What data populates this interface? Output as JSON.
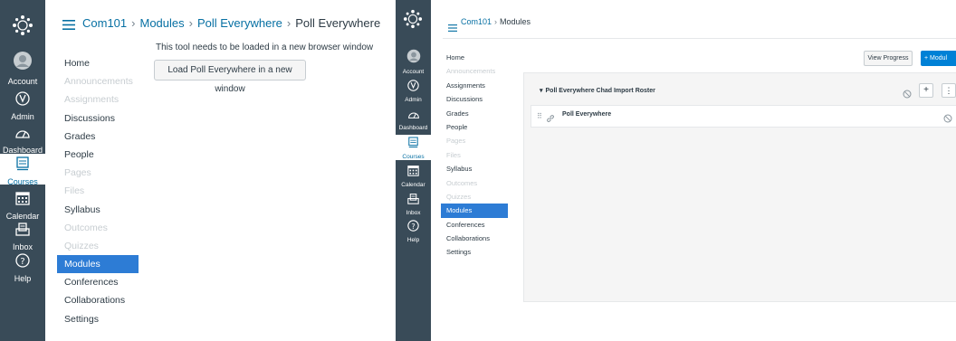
{
  "left": {
    "global_nav": {
      "items": [
        {
          "label": "Account",
          "icon": "account-icon"
        },
        {
          "label": "Admin",
          "icon": "admin-icon"
        },
        {
          "label": "Dashboard",
          "icon": "dashboard-icon"
        },
        {
          "label": "Courses",
          "icon": "courses-icon",
          "active": true
        },
        {
          "label": "Calendar",
          "icon": "calendar-icon"
        },
        {
          "label": "Inbox",
          "icon": "inbox-icon"
        },
        {
          "label": "Help",
          "icon": "help-icon"
        }
      ]
    },
    "breadcrumbs": [
      "Com101",
      "Modules",
      "Poll Everywhere",
      "Poll Everywhere"
    ],
    "course_nav": [
      {
        "label": "Home",
        "state": "normal"
      },
      {
        "label": "Announcements",
        "state": "disabled"
      },
      {
        "label": "Assignments",
        "state": "disabled"
      },
      {
        "label": "Discussions",
        "state": "normal"
      },
      {
        "label": "Grades",
        "state": "normal"
      },
      {
        "label": "People",
        "state": "normal"
      },
      {
        "label": "Pages",
        "state": "disabled"
      },
      {
        "label": "Files",
        "state": "disabled"
      },
      {
        "label": "Syllabus",
        "state": "normal"
      },
      {
        "label": "Outcomes",
        "state": "disabled"
      },
      {
        "label": "Quizzes",
        "state": "disabled"
      },
      {
        "label": "Modules",
        "state": "active"
      },
      {
        "label": "Conferences",
        "state": "normal"
      },
      {
        "label": "Collaborations",
        "state": "normal"
      },
      {
        "label": "Settings",
        "state": "normal"
      }
    ],
    "message": "This tool needs to be loaded in a new browser window",
    "load_button": "Load Poll Everywhere in a new window"
  },
  "right": {
    "global_nav": {
      "items": [
        {
          "label": "Account",
          "icon": "account-icon"
        },
        {
          "label": "Admin",
          "icon": "admin-icon"
        },
        {
          "label": "Dashboard",
          "icon": "dashboard-icon"
        },
        {
          "label": "Courses",
          "icon": "courses-icon",
          "active": true
        },
        {
          "label": "Calendar",
          "icon": "calendar-icon"
        },
        {
          "label": "Inbox",
          "icon": "inbox-icon"
        },
        {
          "label": "Help",
          "icon": "help-icon"
        }
      ]
    },
    "breadcrumbs": [
      "Com101",
      "Modules"
    ],
    "course_nav": [
      {
        "label": "Home",
        "state": "normal"
      },
      {
        "label": "Announcements",
        "state": "disabled"
      },
      {
        "label": "Assignments",
        "state": "normal"
      },
      {
        "label": "Discussions",
        "state": "normal"
      },
      {
        "label": "Grades",
        "state": "normal"
      },
      {
        "label": "People",
        "state": "normal"
      },
      {
        "label": "Pages",
        "state": "disabled"
      },
      {
        "label": "Files",
        "state": "disabled"
      },
      {
        "label": "Syllabus",
        "state": "normal"
      },
      {
        "label": "Outcomes",
        "state": "disabled"
      },
      {
        "label": "Quizzes",
        "state": "disabled"
      },
      {
        "label": "Modules",
        "state": "active"
      },
      {
        "label": "Conferences",
        "state": "normal"
      },
      {
        "label": "Collaborations",
        "state": "normal"
      },
      {
        "label": "Settings",
        "state": "normal"
      }
    ],
    "view_progress": "View Progress",
    "add_module": "+ Modul",
    "module": {
      "title": "Poll Everywhere Chad Import Roster",
      "items": [
        {
          "title": "Poll Everywhere"
        }
      ]
    }
  },
  "colors": {
    "global_nav_bg": "#394B58",
    "link": "#0770A3",
    "active_nav": "#2D7CD5",
    "primary_button": "#0081D6"
  }
}
